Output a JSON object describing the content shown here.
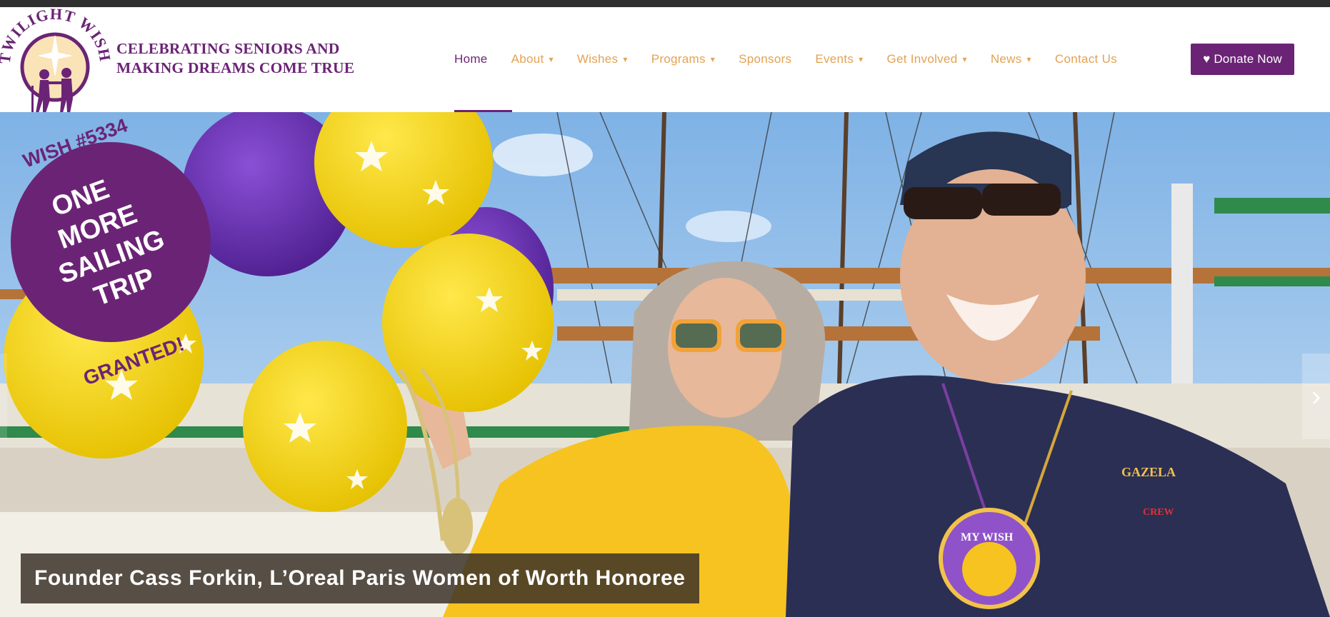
{
  "brand": {
    "logo_text": "TWILIGHT WISH",
    "tagline_line1": "CELEBRATING SENIORS AND",
    "tagline_line2": "MAKING DREAMS COME TRUE"
  },
  "nav": {
    "items": [
      {
        "label": "Home",
        "caret": "",
        "active": true
      },
      {
        "label": "About",
        "caret": "▾"
      },
      {
        "label": "Wishes",
        "caret": "▾"
      },
      {
        "label": "Programs",
        "caret": "▾"
      },
      {
        "label": "Sponsors",
        "caret": ""
      },
      {
        "label": "Events",
        "caret": "▾"
      },
      {
        "label": "Get Involved",
        "caret": "▾"
      },
      {
        "label": "News",
        "caret": "▾"
      },
      {
        "label": "Contact Us",
        "caret": ""
      }
    ],
    "donate_label": "♥ Donate Now"
  },
  "hero": {
    "badge_top": "WISH #5334",
    "badge_line1": "ONE",
    "badge_line2": "MORE",
    "badge_line3": "SAILING",
    "badge_line4": "TRIP",
    "badge_bottom": "GRANTED!",
    "caption": "Founder Cass Forkin, L’Oreal Paris Women of Worth Honoree",
    "shirt_logo": "GAZELA",
    "shirt_sub": "CREW",
    "pin_text": "MY WISH",
    "next_icon": "›"
  },
  "colors": {
    "brand_purple": "#6b2475",
    "nav_orange": "#e3a252",
    "balloon_yellow": "#f2d21a",
    "balloon_purple": "#6a2fb0"
  }
}
